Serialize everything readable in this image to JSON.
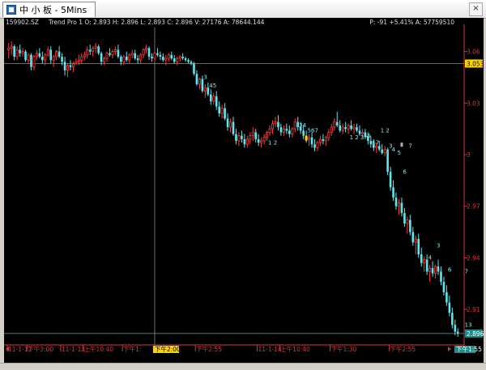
{
  "window": {
    "tab_title": "中 小 板 - 5Mins",
    "close_glyph": "×"
  },
  "info": {
    "symbol": "159902.SZ",
    "indicator": "Trend Pro 1 O: 2.893 H: 2.896 L: 2.893 C: 2.896 V: 27176 A: 78644.144",
    "right": "P: -91 +5.41% A: 57759510"
  },
  "crosshair": {
    "price_label": "3.053",
    "time_label": "下午2:00"
  },
  "last_price": {
    "label": "2.896"
  },
  "last_time": {
    "label": "下午1:55"
  },
  "colors": {
    "up": "#ff3b3b",
    "down": "#5ee6ee",
    "axis": "#d23a3a",
    "highlight": "#ffd400"
  },
  "chart_data": {
    "type": "candlestick",
    "y_ticks": [
      {
        "v": 3.06,
        "t": "3.06"
      },
      {
        "v": 3.03,
        "t": "3.03"
      },
      {
        "v": 3.0,
        "t": "3"
      },
      {
        "v": 2.97,
        "t": "2.97"
      },
      {
        "v": 2.94,
        "t": "2.94"
      },
      {
        "v": 2.91,
        "t": "2.91"
      }
    ],
    "x_ticks": [
      {
        "i": 0,
        "t": "11-1-12"
      },
      {
        "i": 7,
        "t": "下午3:00"
      },
      {
        "i": 19,
        "t": "11-1-13"
      },
      {
        "i": 27,
        "t": "上午10:40"
      },
      {
        "i": 41,
        "t": "下午1:"
      },
      {
        "i": 67,
        "t": "下午2:55"
      },
      {
        "i": 89,
        "t": "11-1-14"
      },
      {
        "i": 97,
        "t": "上午10:40"
      },
      {
        "i": 115,
        "t": "下午1:30"
      },
      {
        "i": 136,
        "t": "下午2:55"
      }
    ],
    "last_close": 2.896,
    "crosshair_index": 52,
    "crosshair_price": 3.053,
    "price_range": [
      2.895,
      3.073
    ],
    "wave_labels": [
      {
        "i": 70,
        "p": 3.044,
        "t": "3"
      },
      {
        "i": 72,
        "p": 3.039,
        "t": "45"
      },
      {
        "i": 104,
        "p": 3.016,
        "t": "34"
      },
      {
        "i": 107,
        "p": 3.013,
        "t": "567"
      },
      {
        "i": 93,
        "p": 3.006,
        "t": "1 2"
      },
      {
        "i": 122,
        "p": 3.009,
        "t": "1 2 3"
      },
      {
        "i": 127,
        "p": 3.01,
        "t": "45"
      },
      {
        "i": 130,
        "p": 3.006,
        "t": "67"
      },
      {
        "i": 133,
        "p": 3.013,
        "t": "1 2"
      },
      {
        "i": 136,
        "p": 3.004,
        "t": "3"
      },
      {
        "i": 137,
        "p": 3.002,
        "t": "4"
      },
      {
        "i": 139,
        "p": 3.0,
        "t": "5"
      },
      {
        "i": 143,
        "p": 3.004,
        "t": "7"
      },
      {
        "i": 141,
        "p": 2.989,
        "t": "6"
      },
      {
        "i": 150,
        "p": 2.939,
        "t": "4"
      },
      {
        "i": 157,
        "p": 2.932,
        "t": "6"
      },
      {
        "i": 163,
        "p": 2.931,
        "t": "7"
      },
      {
        "i": 153,
        "p": 2.946,
        "t": "3"
      },
      {
        "i": 163,
        "p": 2.9,
        "t": "13"
      }
    ],
    "candles": [
      [
        3.061,
        3.065,
        3.056,
        3.062
      ],
      [
        3.062,
        3.066,
        3.058,
        3.063
      ],
      [
        3.063,
        3.064,
        3.055,
        3.057
      ],
      [
        3.057,
        3.063,
        3.055,
        3.061
      ],
      [
        3.061,
        3.064,
        3.057,
        3.059
      ],
      [
        3.059,
        3.062,
        3.057,
        3.06
      ],
      [
        3.06,
        3.061,
        3.054,
        3.055
      ],
      [
        3.055,
        3.059,
        3.053,
        3.058
      ],
      [
        3.058,
        3.059,
        3.049,
        3.051
      ],
      [
        3.051,
        3.058,
        3.049,
        3.057
      ],
      [
        3.057,
        3.061,
        3.055,
        3.059
      ],
      [
        3.059,
        3.062,
        3.056,
        3.057
      ],
      [
        3.057,
        3.06,
        3.053,
        3.055
      ],
      [
        3.055,
        3.059,
        3.052,
        3.058
      ],
      [
        3.058,
        3.063,
        3.057,
        3.061
      ],
      [
        3.061,
        3.063,
        3.053,
        3.055
      ],
      [
        3.055,
        3.058,
        3.051,
        3.057
      ],
      [
        3.057,
        3.061,
        3.055,
        3.06
      ],
      [
        3.06,
        3.063,
        3.056,
        3.057
      ],
      [
        3.057,
        3.059,
        3.052,
        3.054
      ],
      [
        3.054,
        3.057,
        3.046,
        3.049
      ],
      [
        3.049,
        3.053,
        3.045,
        3.052
      ],
      [
        3.052,
        3.055,
        3.049,
        3.051
      ],
      [
        3.051,
        3.054,
        3.048,
        3.053
      ],
      [
        3.053,
        3.056,
        3.052,
        3.054
      ],
      [
        3.054,
        3.058,
        3.052,
        3.055
      ],
      [
        3.055,
        3.059,
        3.053,
        3.057
      ],
      [
        3.057,
        3.06,
        3.055,
        3.058
      ],
      [
        3.058,
        3.063,
        3.056,
        3.061
      ],
      [
        3.061,
        3.064,
        3.058,
        3.06
      ],
      [
        3.06,
        3.063,
        3.057,
        3.062
      ],
      [
        3.062,
        3.065,
        3.059,
        3.063
      ],
      [
        3.063,
        3.064,
        3.058,
        3.059
      ],
      [
        3.059,
        3.06,
        3.052,
        3.054
      ],
      [
        3.054,
        3.057,
        3.052,
        3.056
      ],
      [
        3.056,
        3.06,
        3.054,
        3.059
      ],
      [
        3.059,
        3.062,
        3.057,
        3.058
      ],
      [
        3.058,
        3.061,
        3.056,
        3.06
      ],
      [
        3.06,
        3.063,
        3.058,
        3.061
      ],
      [
        3.061,
        3.064,
        3.056,
        3.057
      ],
      [
        3.057,
        3.058,
        3.052,
        3.054
      ],
      [
        3.054,
        3.058,
        3.052,
        3.057
      ],
      [
        3.057,
        3.06,
        3.054,
        3.055
      ],
      [
        3.055,
        3.059,
        3.053,
        3.058
      ],
      [
        3.058,
        3.061,
        3.056,
        3.059
      ],
      [
        3.059,
        3.061,
        3.055,
        3.056
      ],
      [
        3.056,
        3.058,
        3.053,
        3.055
      ],
      [
        3.055,
        3.059,
        3.053,
        3.058
      ],
      [
        3.058,
        3.062,
        3.056,
        3.061
      ],
      [
        3.061,
        3.064,
        3.059,
        3.062
      ],
      [
        3.062,
        3.063,
        3.055,
        3.057
      ],
      [
        3.057,
        3.059,
        3.054,
        3.056
      ],
      [
        3.056,
        3.06,
        3.054,
        3.059
      ],
      [
        3.059,
        3.062,
        3.057,
        3.058
      ],
      [
        3.058,
        3.06,
        3.055,
        3.057
      ],
      [
        3.057,
        3.059,
        3.054,
        3.055
      ],
      [
        3.055,
        3.058,
        3.052,
        3.056
      ],
      [
        3.056,
        3.059,
        3.054,
        3.058
      ],
      [
        3.058,
        3.06,
        3.055,
        3.056
      ],
      [
        3.056,
        3.058,
        3.053,
        3.054
      ],
      [
        3.054,
        3.057,
        3.052,
        3.056
      ],
      [
        3.056,
        3.058,
        3.054,
        3.057
      ],
      [
        3.057,
        3.059,
        3.055,
        3.056
      ],
      [
        3.056,
        3.057,
        3.054,
        3.055
      ],
      [
        3.055,
        3.056,
        3.053,
        3.054
      ],
      [
        3.054,
        3.055,
        3.052,
        3.053
      ],
      [
        3.053,
        3.054,
        3.046,
        3.047
      ],
      [
        3.047,
        3.049,
        3.04,
        3.041
      ],
      [
        3.041,
        3.045,
        3.038,
        3.044
      ],
      [
        3.044,
        3.046,
        3.036,
        3.037
      ],
      [
        3.037,
        3.041,
        3.033,
        3.039
      ],
      [
        3.039,
        3.042,
        3.034,
        3.035
      ],
      [
        3.035,
        3.038,
        3.029,
        3.031
      ],
      [
        3.031,
        3.036,
        3.029,
        3.034
      ],
      [
        3.034,
        3.037,
        3.026,
        3.028
      ],
      [
        3.028,
        3.031,
        3.022,
        3.024
      ],
      [
        3.024,
        3.029,
        3.021,
        3.027
      ],
      [
        3.027,
        3.03,
        3.02,
        3.021
      ],
      [
        3.021,
        3.024,
        3.014,
        3.016
      ],
      [
        3.016,
        3.021,
        3.013,
        3.019
      ],
      [
        3.019,
        3.022,
        3.011,
        3.012
      ],
      [
        3.012,
        3.015,
        3.006,
        3.008
      ],
      [
        3.008,
        3.013,
        3.005,
        3.011
      ],
      [
        3.011,
        3.014,
        3.007,
        3.009
      ],
      [
        3.009,
        3.012,
        3.004,
        3.006
      ],
      [
        3.006,
        3.011,
        3.004,
        3.009
      ],
      [
        3.009,
        3.013,
        3.006,
        3.011
      ],
      [
        3.011,
        3.016,
        3.008,
        3.013
      ],
      [
        3.013,
        3.015,
        3.007,
        3.009
      ],
      [
        3.009,
        3.012,
        3.005,
        3.007
      ],
      [
        3.007,
        3.01,
        3.004,
        3.008
      ],
      [
        3.008,
        3.012,
        3.006,
        3.01
      ],
      [
        3.01,
        3.014,
        3.008,
        3.013
      ],
      [
        3.013,
        3.017,
        3.011,
        3.015
      ],
      [
        3.015,
        3.02,
        3.012,
        3.018
      ],
      [
        3.018,
        3.022,
        3.016,
        3.019
      ],
      [
        3.019,
        3.023,
        3.014,
        3.016
      ],
      [
        3.016,
        3.018,
        3.011,
        3.013
      ],
      [
        3.013,
        3.017,
        3.011,
        3.015
      ],
      [
        3.015,
        3.018,
        3.012,
        3.014
      ],
      [
        3.014,
        3.017,
        3.01,
        3.012
      ],
      [
        3.012,
        3.016,
        3.01,
        3.015
      ],
      [
        3.015,
        3.021,
        3.013,
        3.019
      ],
      [
        3.019,
        3.022,
        3.014,
        3.016
      ],
      [
        3.016,
        3.019,
        3.012,
        3.014
      ],
      [
        3.014,
        3.017,
        3.009,
        3.011
      ],
      [
        3.011,
        3.014,
        3.007,
        3.009
      ],
      [
        3.009,
        3.012,
        3.005,
        3.01
      ],
      [
        3.01,
        3.013,
        3.004,
        3.006
      ],
      [
        3.006,
        3.009,
        3.002,
        3.004
      ],
      [
        3.004,
        3.008,
        3.002,
        3.007
      ],
      [
        3.007,
        3.011,
        3.005,
        3.009
      ],
      [
        3.009,
        3.012,
        3.006,
        3.008
      ],
      [
        3.008,
        3.011,
        3.005,
        3.01
      ],
      [
        3.01,
        3.015,
        3.008,
        3.013
      ],
      [
        3.013,
        3.018,
        3.011,
        3.016
      ],
      [
        3.016,
        3.021,
        3.014,
        3.019
      ],
      [
        3.019,
        3.025,
        3.016,
        3.017
      ],
      [
        3.017,
        3.02,
        3.013,
        3.014
      ],
      [
        3.014,
        3.018,
        3.012,
        3.016
      ],
      [
        3.016,
        3.019,
        3.013,
        3.015
      ],
      [
        3.015,
        3.018,
        3.012,
        3.017
      ],
      [
        3.017,
        3.02,
        3.014,
        3.015
      ],
      [
        3.015,
        3.018,
        3.012,
        3.016
      ],
      [
        3.016,
        3.018,
        3.013,
        3.014
      ],
      [
        3.014,
        3.017,
        3.011,
        3.012
      ],
      [
        3.012,
        3.015,
        3.01,
        3.013
      ],
      [
        3.013,
        3.015,
        3.009,
        3.011
      ],
      [
        3.011,
        3.013,
        3.006,
        3.008
      ],
      [
        3.008,
        3.011,
        3.004,
        3.006
      ],
      [
        3.006,
        3.009,
        3.002,
        3.004
      ],
      [
        3.004,
        3.007,
        3.001,
        3.005
      ],
      [
        3.005,
        3.008,
        3.002,
        3.003
      ],
      [
        3.003,
        3.006,
        3.0,
        3.001
      ],
      [
        3.001,
        3.005,
        2.999,
        3.003
      ],
      [
        3.003,
        3.004,
        2.988,
        2.99
      ],
      [
        2.99,
        2.993,
        2.979,
        2.981
      ],
      [
        2.981,
        2.985,
        2.973,
        2.975
      ],
      [
        2.975,
        2.978,
        2.968,
        2.97
      ],
      [
        2.97,
        2.974,
        2.965,
        2.972
      ],
      [
        2.972,
        2.975,
        2.964,
        2.966
      ],
      [
        2.966,
        2.969,
        2.958,
        2.96
      ],
      [
        2.96,
        2.964,
        2.954,
        2.962
      ],
      [
        2.962,
        2.965,
        2.953,
        2.955
      ],
      [
        2.955,
        2.958,
        2.947,
        2.949
      ],
      [
        2.949,
        2.953,
        2.942,
        2.951
      ],
      [
        2.951,
        2.954,
        2.94,
        2.942
      ],
      [
        2.942,
        2.946,
        2.935,
        2.937
      ],
      [
        2.937,
        2.941,
        2.932,
        2.939
      ],
      [
        2.939,
        2.942,
        2.93,
        2.932
      ],
      [
        2.932,
        2.936,
        2.926,
        2.934
      ],
      [
        2.934,
        2.938,
        2.929,
        2.931
      ],
      [
        2.931,
        2.936,
        2.928,
        2.935
      ],
      [
        2.935,
        2.939,
        2.93,
        2.932
      ],
      [
        2.932,
        2.935,
        2.924,
        2.926
      ],
      [
        2.926,
        2.929,
        2.918,
        2.92
      ],
      [
        2.92,
        2.924,
        2.912,
        2.914
      ],
      [
        2.914,
        2.918,
        2.906,
        2.908
      ],
      [
        2.908,
        2.911,
        2.899,
        2.901
      ],
      [
        2.901,
        2.904,
        2.895,
        2.897
      ],
      [
        2.897,
        2.899,
        2.894,
        2.896
      ]
    ]
  }
}
